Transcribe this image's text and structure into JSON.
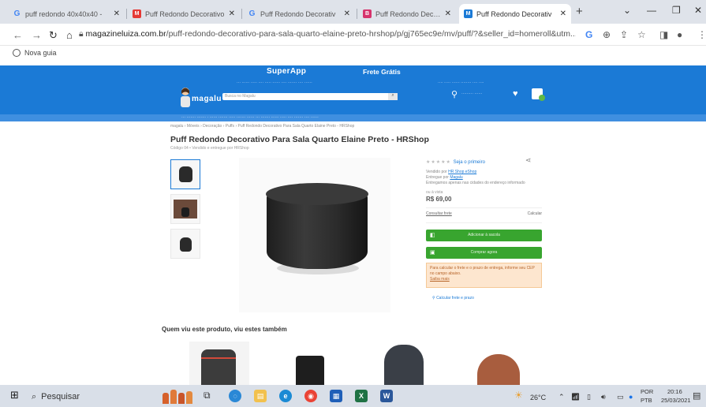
{
  "tabs": [
    {
      "title": "puff redondo 40x40x40 -",
      "favicon": "google-icon",
      "active": false
    },
    {
      "title": "Puff Redondo Decorativo",
      "favicon": "magalu-icon",
      "active": false
    },
    {
      "title": "Puff Redondo Decorativ",
      "favicon": "google-icon",
      "active": false
    },
    {
      "title": "Puff Redondo Decorativ",
      "favicon": "bookmark-icon",
      "active": false
    },
    {
      "title": "Puff Redondo Decorativ",
      "favicon": "magalu-icon",
      "active": true
    }
  ],
  "address_bar": {
    "host": "magazineluiza.com.br",
    "path": "/puff-redondo-decorativo-para-sala-quarto-elaine-preto-hrshop/p/gj765ec9e/mv/puff/?&seller_id=homeroll&utm..."
  },
  "bookmarks": {
    "new_guide": "Nova guia"
  },
  "header": {
    "superapp": "SuperApp",
    "promo": "Frete Grátis",
    "logo": "magalu",
    "search_placeholder": "Busca no Magalu"
  },
  "breadcrumb": "magalu › Móveis › Decoração › Puffs › Puff Redondo Decorativo Para Sala Quarto Elaine Preto - HRShop",
  "product": {
    "title": "Puff Redondo Decorativo Para Sala Quarto Elaine Preto - HRShop",
    "subtitle": "Código 04 • Vendido e entregue por HRShop",
    "rating_label": "Seja o primeiro",
    "seller_prefix": "Vendido por",
    "seller": "HR Shop eShop",
    "delivery_prefix": "Entregue por",
    "delivery": "Magalu",
    "install": "Entregamos apenas nas cidades do endereço informado",
    "price_label": "ou à vista",
    "price": "R$ 69,00",
    "qty_label": "Consultar frete",
    "qty_right": "Calcular",
    "buy_button": "Adicionar à sacola",
    "buy_now_button": "Comprar agora",
    "alert": "Para calcular o frete e o prazo de entrega, informe seu CEP no campo abaixo.",
    "alert_link": "Saiba mais",
    "cep_link": "Calcular frete e prazo"
  },
  "related_title": "Quem viu este produto, viu estes também",
  "taskbar": {
    "search": "Pesquisar",
    "weather": "26°C",
    "lang_top": "POR",
    "lang_bottom": "PTB",
    "time": "20:16",
    "date": "25/03/2021"
  }
}
